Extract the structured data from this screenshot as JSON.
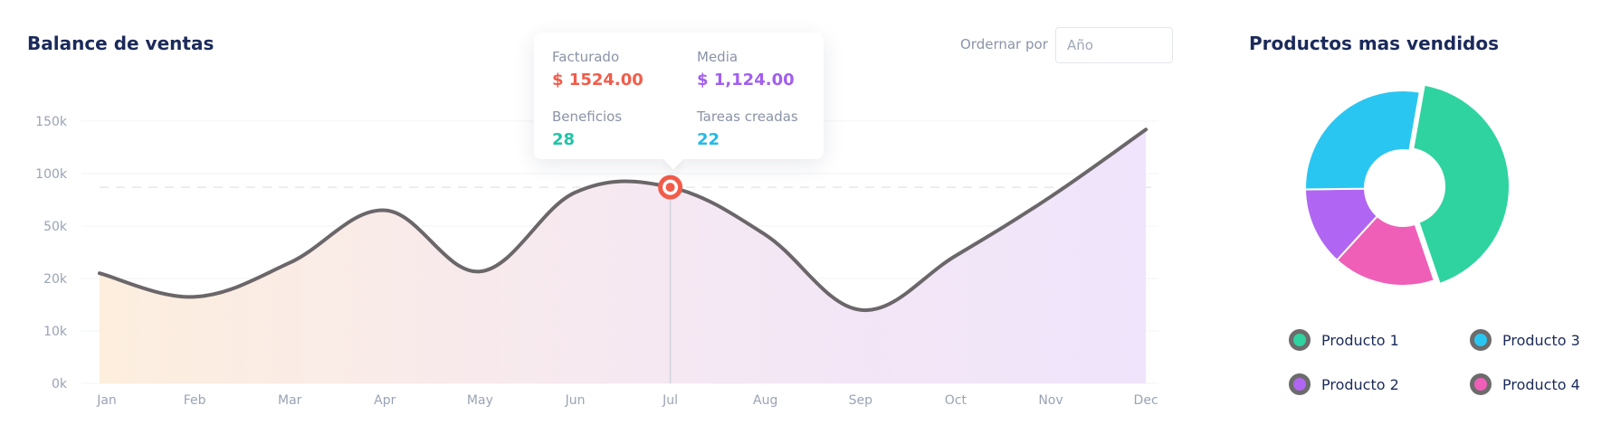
{
  "sales": {
    "title": "Balance de ventas",
    "sort_label": "Ordernar por",
    "select_placeholder": "Año"
  },
  "tooltip": {
    "facturado_label": "Facturado",
    "facturado_value": "$ 1524.00",
    "media_label": "Media",
    "media_value": "$ 1,124.00",
    "beneficios_label": "Beneficios",
    "beneficios_value": "28",
    "tareas_label": "Tareas creadas",
    "tareas_value": "22",
    "colors": {
      "facturado": "#f25c4a",
      "media": "#a25ff0",
      "beneficios": "#22c3a6",
      "tareas": "#27b9e6"
    }
  },
  "products": {
    "title": "Productos mas vendidos",
    "legend": [
      {
        "label": "Producto 1",
        "color": "#2fd3a0"
      },
      {
        "label": "Producto 2",
        "color": "#b066f2"
      },
      {
        "label": "Producto 3",
        "color": "#2ac6f2"
      },
      {
        "label": "Producto 4",
        "color": "#ef5fb8"
      }
    ]
  },
  "chart_data": [
    {
      "type": "area",
      "title": "Balance de ventas",
      "categories": [
        "Jan",
        "Feb",
        "Mar",
        "Apr",
        "May",
        "Jun",
        "Jul",
        "Aug",
        "Sep",
        "Oct",
        "Nov",
        "Dec"
      ],
      "y_ticks": [
        "0k",
        "10k",
        "20k",
        "50k",
        "100k",
        "150k"
      ],
      "series": [
        {
          "values": [
            23,
            16.5,
            29,
            65,
            24,
            82,
            87,
            45,
            14,
            33,
            78,
            142
          ]
        }
      ],
      "highlight": {
        "category": "Jul",
        "value": 87
      },
      "reference_line": 87,
      "colors": {
        "line": "#6b6669",
        "fill_start": "#fdeede",
        "fill_end": "#efe4fb",
        "highlight": "#f25c4a"
      }
    },
    {
      "type": "pie",
      "title": "Productos mas vendidos",
      "labels": [
        "Producto 1",
        "Producto 2",
        "Producto 3",
        "Producto 4"
      ],
      "values": [
        42,
        13,
        28,
        17
      ],
      "colors": [
        "#2fd3a0",
        "#b066f2",
        "#2ac6f2",
        "#ef5fb8"
      ]
    }
  ]
}
